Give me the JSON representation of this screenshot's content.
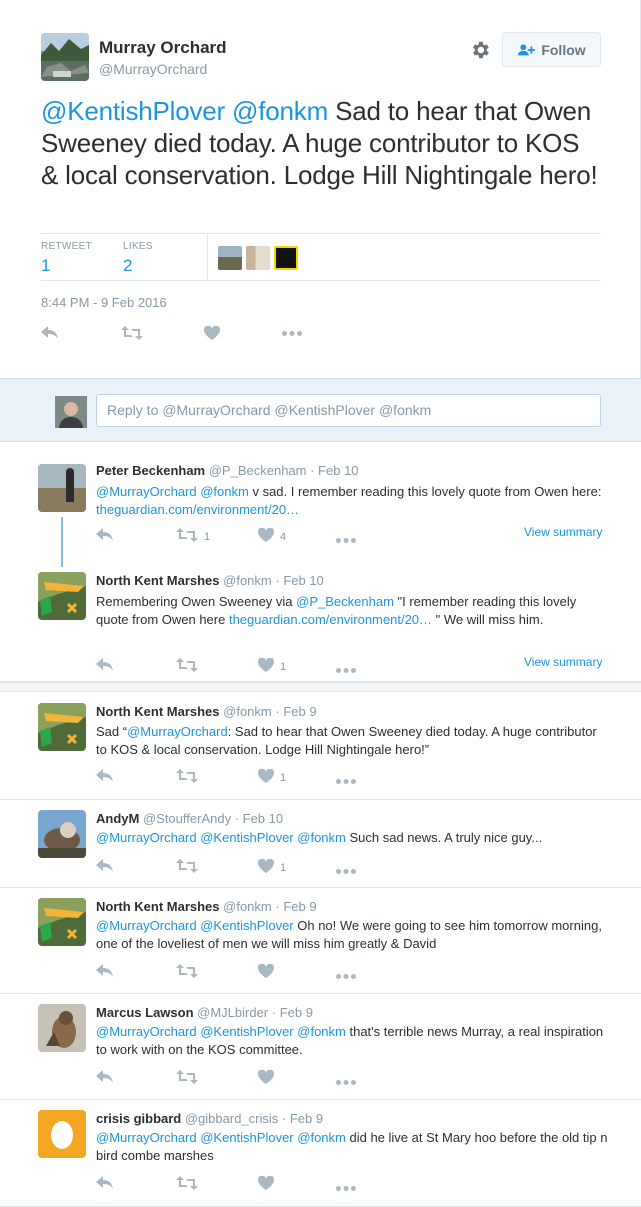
{
  "main_tweet": {
    "author_name": "Murray Orchard",
    "author_handle": "@MurrayOrchard",
    "follow_label": "Follow",
    "mention1": "@KentishPlover",
    "mention2": "@fonkm",
    "text": " Sad to hear that Owen Sweeney died today. A huge contributor to KOS & local conservation. Lodge Hill Nightingale hero!",
    "retweets_label": "RETWEET",
    "retweets_count": "1",
    "likes_label": "LIKES",
    "likes_count": "2",
    "timestamp": "8:44 PM - 9 Feb 2016"
  },
  "reply_box": {
    "placeholder": "Reply to @MurrayOrchard @KentishPlover @fonkm"
  },
  "replies": [
    {
      "name": "Peter Beckenham",
      "handle": "@P_Beckenham",
      "date": "Feb 10",
      "body_parts": [
        "@MurrayOrchard",
        " ",
        "@fonkm",
        " v sad. I remember reading this lovely quote from Owen here: ",
        "theguardian.com/environment/20…"
      ],
      "retweets": "1",
      "likes": "4",
      "view_summary": "View summary"
    },
    {
      "name": "North Kent Marshes",
      "handle": "@fonkm",
      "date": "Feb 10",
      "body_parts": [
        "Remembering Owen Sweeney  via ",
        "@P_Beckenham",
        " \"I remember reading this lovely quote from Owen here ",
        "theguardian.com/environment/20…",
        " \" We will miss him."
      ],
      "retweets": "",
      "likes": "1",
      "view_summary": "View summary"
    },
    {
      "name": "North Kent Marshes",
      "handle": "@fonkm",
      "date": "Feb 9",
      "body_parts": [
        "Sad “",
        "@MurrayOrchard",
        ": Sad to hear that Owen Sweeney died today. A huge contributor to KOS & local conservation. Lodge Hill Nightingale hero!”"
      ],
      "retweets": "",
      "likes": "1"
    },
    {
      "name": "AndyM",
      "handle": "@StoufferAndy",
      "date": "Feb 10",
      "body_parts": [
        "@MurrayOrchard",
        " ",
        "@KentishPlover",
        " ",
        "@fonkm",
        " Such sad news. A truly nice guy..."
      ],
      "retweets": "",
      "likes": "1"
    },
    {
      "name": "North Kent Marshes",
      "handle": "@fonkm",
      "date": "Feb 9",
      "body_parts": [
        "@MurrayOrchard",
        " ",
        "@KentishPlover",
        " Oh no! We were going to see him tomorrow morning, one of the loveliest of men we will miss him greatly & David"
      ],
      "retweets": "",
      "likes": ""
    },
    {
      "name": "Marcus Lawson",
      "handle": "@MJLbirder",
      "date": "Feb 9",
      "body_parts": [
        "@MurrayOrchard",
        " ",
        "@KentishPlover",
        " ",
        "@fonkm",
        " that's terrible news Murray, a real inspiration to work with on the KOS committee."
      ],
      "retweets": "",
      "likes": ""
    },
    {
      "name": "crisis gibbard",
      "handle": "@gibbard_crisis",
      "date": "Feb 9",
      "body_parts": [
        "@MurrayOrchard",
        " ",
        "@KentishPlover",
        " ",
        "@fonkm",
        " did he live at St Mary hoo before the old tip n bird combe marshes"
      ],
      "retweets": "",
      "likes": ""
    }
  ],
  "separator": " · ",
  "colors": {
    "link": "#1b95e0",
    "text": "#292f33",
    "muted": "#8899a6",
    "icon": "#aab8c2"
  }
}
